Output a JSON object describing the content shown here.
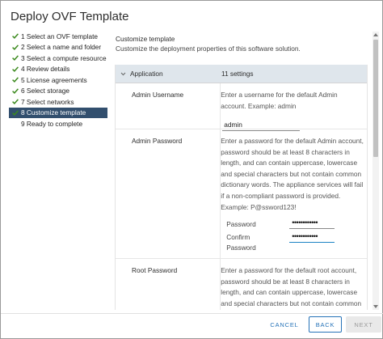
{
  "window": {
    "title": "Deploy OVF Template"
  },
  "steps": [
    {
      "label": "1 Select an OVF template",
      "done": true,
      "active": false
    },
    {
      "label": "2 Select a name and folder",
      "done": true,
      "active": false
    },
    {
      "label": "3 Select a compute resource",
      "done": true,
      "active": false
    },
    {
      "label": "4 Review details",
      "done": true,
      "active": false
    },
    {
      "label": "5 License agreements",
      "done": true,
      "active": false
    },
    {
      "label": "6 Select storage",
      "done": true,
      "active": false
    },
    {
      "label": "7 Select networks",
      "done": true,
      "active": false
    },
    {
      "label": "8 Customize template",
      "done": true,
      "active": true
    },
    {
      "label": "9 Ready to complete",
      "done": false,
      "active": false
    }
  ],
  "section": {
    "title": "Customize template",
    "subtitle": "Customize the deployment properties of this software solution."
  },
  "group": {
    "name": "Application",
    "count": "11 settings"
  },
  "settings": {
    "admin_username": {
      "label": "Admin Username",
      "desc": "Enter a username for the default Admin account. Example: admin",
      "value": "admin"
    },
    "admin_password": {
      "label": "Admin Password",
      "desc": "Enter a password for the default Admin account, password should be at least 8 characters in length, and can contain uppercase, lowercase and special characters but not contain common dictionary words. The appliance services will fail if a non-compliant password is provided. Example: P@ssword123!",
      "password_label": "Password",
      "password_value": "••••••••••••",
      "confirm_label": "Confirm",
      "confirm_label2": "Password",
      "confirm_value": "••••••••••••"
    },
    "root_password": {
      "label": "Root Password",
      "desc": "Enter a password for the default root account, password should be at least 8 characters in length, and can contain uppercase, lowercase and special characters but not contain common dictionary words. The appliance services will fail"
    }
  },
  "footer": {
    "cancel": "CANCEL",
    "back": "BACK",
    "next": "NEXT"
  },
  "colors": {
    "active_step_bg": "#324f6e",
    "check_green": "#3c8a1e",
    "group_bg": "#dfe6ec",
    "link_blue": "#2673b8"
  }
}
